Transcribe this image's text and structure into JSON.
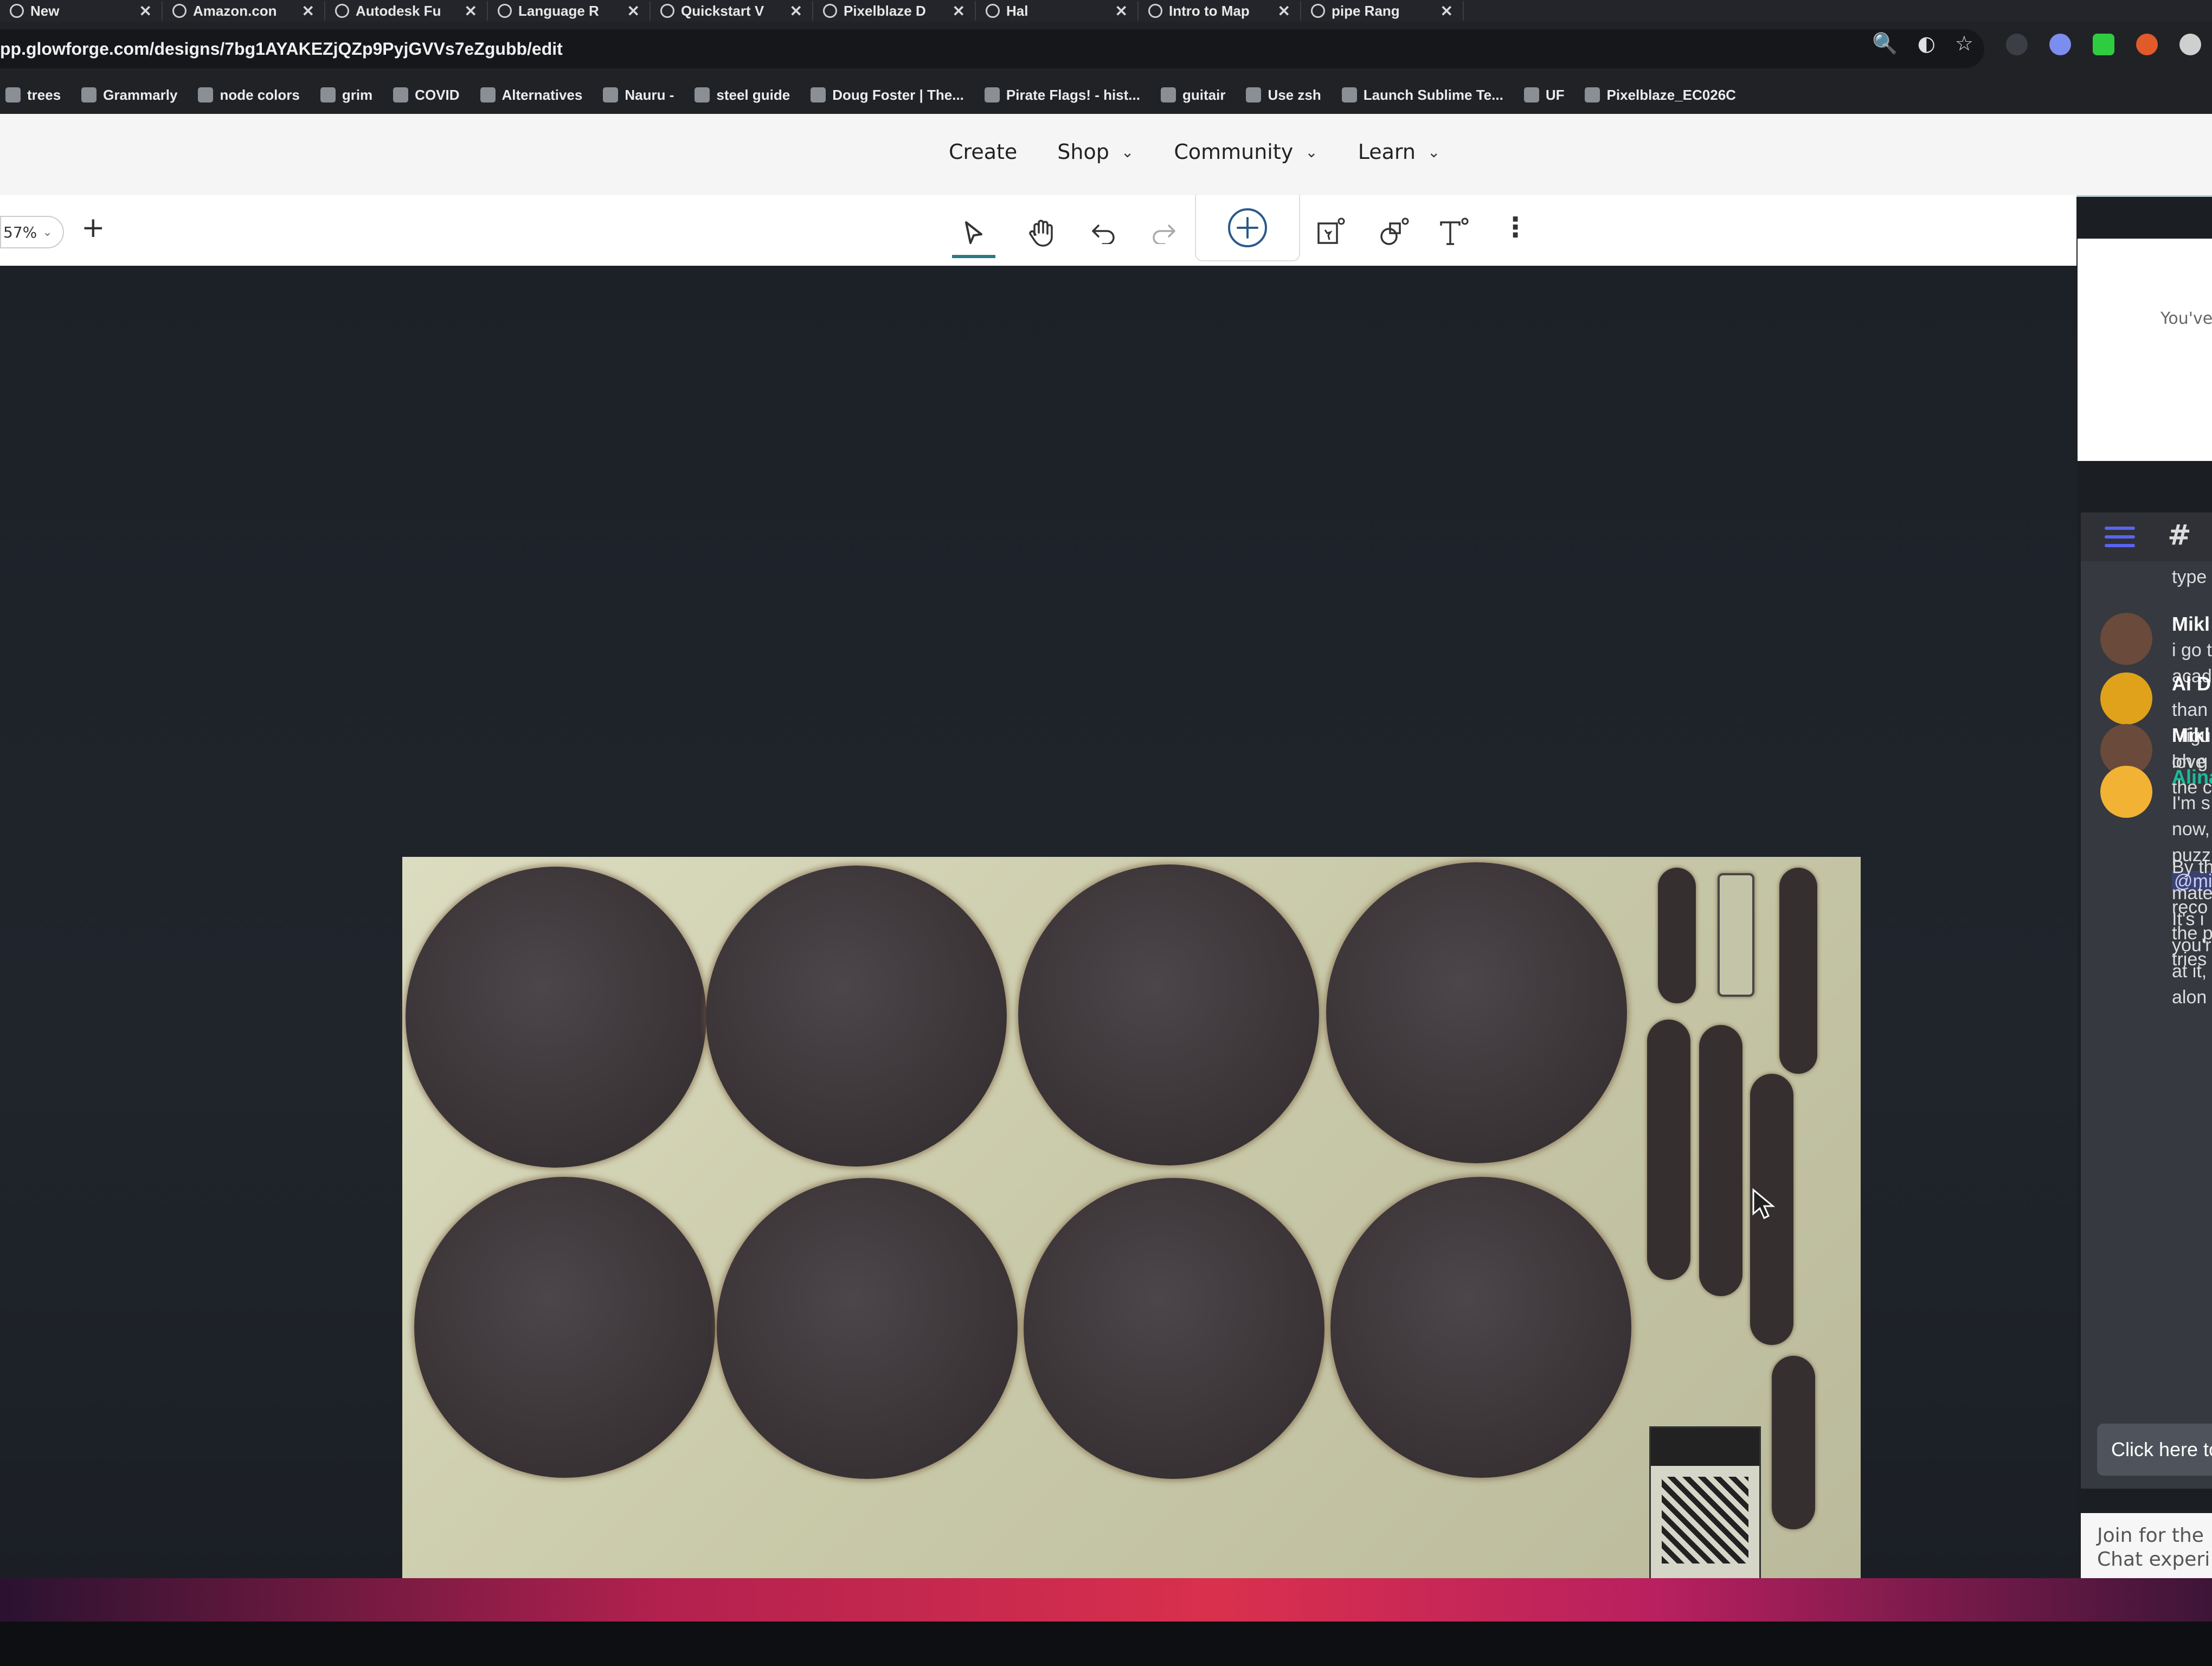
{
  "browser": {
    "tabs": [
      {
        "title": "New"
      },
      {
        "title": "Amazon.con"
      },
      {
        "title": "Autodesk Fu"
      },
      {
        "title": "Language R"
      },
      {
        "title": "Quickstart V"
      },
      {
        "title": "Pixelblaze D"
      },
      {
        "title": "Hal"
      },
      {
        "title": "Intro to Map"
      },
      {
        "title": "pipe Rang"
      }
    ],
    "url": "pp.glowforge.com/designs/7bg1AYAKEZjQZp9PyjGVVs7eZgubb/edit",
    "bookmarks": [
      {
        "label": "trees",
        "icon": "tree-icon"
      },
      {
        "label": "Grammarly",
        "icon": "grammarly-icon"
      },
      {
        "label": "node colors",
        "icon": "doc-icon"
      },
      {
        "label": "grim",
        "icon": "grim-icon"
      },
      {
        "label": "COVID",
        "icon": "covid-icon"
      },
      {
        "label": "Alternatives",
        "icon": "alternatives-icon"
      },
      {
        "label": "Nauru -",
        "icon": "wiki-icon"
      },
      {
        "label": "steel guide",
        "icon": "shield-icon"
      },
      {
        "label": "Doug Foster | The...",
        "icon": "s-icon"
      },
      {
        "label": "Pirate Flags! - hist...",
        "icon": "flag-icon"
      },
      {
        "label": "guitair",
        "icon": "tab-icon"
      },
      {
        "label": "Use zsh",
        "icon": "apple-icon"
      },
      {
        "label": "Launch Sublime Te...",
        "icon": "github-icon"
      },
      {
        "label": "UF",
        "icon": "folder-icon"
      },
      {
        "label": "Pixelblaze_EC026C",
        "icon": "pixelblaze-icon"
      }
    ]
  },
  "nav": {
    "create": "Create",
    "shop": "Shop",
    "community": "Community",
    "learn": "Learn"
  },
  "toolbar": {
    "zoom": "57%",
    "add_label": "+"
  },
  "side_panel": {
    "note": "You've"
  },
  "chat": {
    "messages": [
      {
        "author": "",
        "lines": [
          "type"
        ]
      },
      {
        "author": "Mikl",
        "lines": [
          "i go t",
          "acad"
        ],
        "avatar_color": "#6a4a3a"
      },
      {
        "author": "Al D",
        "lines": [
          "than",
          "i figu",
          "love"
        ],
        "avatar_color": "#e0a21a"
      },
      {
        "author": "Mikl",
        "lines": [
          "oh g",
          "the c"
        ],
        "avatar_color": "#6a4a3a"
      },
      {
        "author": "Alina",
        "lines": [
          "I'm s",
          "now,",
          "puzz",
          "@mi",
          "reco",
          "the p",
          "tries"
        ],
        "avatar_color": "#f2b233"
      },
      {
        "author": "",
        "lines": [
          "By th",
          "mate",
          "It's i",
          "you'r",
          "at it,",
          "alon"
        ]
      }
    ],
    "click_here": "Click here to",
    "join_line1": "Join for the",
    "join_line2": "Chat experi"
  },
  "colors": {
    "accent": "#2a7b84",
    "chat_bg": "#36393f",
    "discord_blue": "#5865f2",
    "author_alina": "#1abc9c"
  }
}
